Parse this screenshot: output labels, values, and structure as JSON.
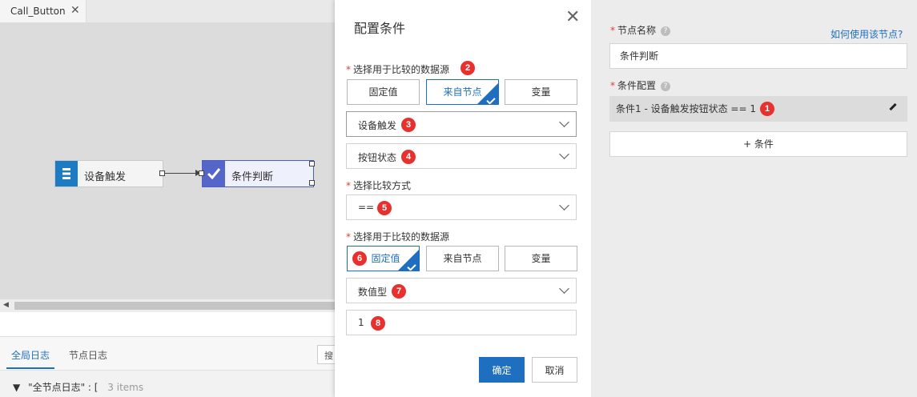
{
  "tab": {
    "title": "Call_Button",
    "close": "✕"
  },
  "canvas": {
    "nodes": [
      {
        "label": "设备触发",
        "icon": "device-trigger-icon"
      },
      {
        "label": "条件判断",
        "icon": "check-icon"
      }
    ]
  },
  "log": {
    "tabs": [
      "全局日志",
      "节点日志"
    ],
    "search_stub": "搜",
    "line": {
      "arrow": "▼",
      "key": "\"全节点日志\" : [",
      "count": "3 items"
    }
  },
  "modal": {
    "title": "配置条件",
    "close": "✕",
    "source1": {
      "label": "选择用于比较的数据源",
      "badge": "2",
      "options": [
        "固定值",
        "来自节点",
        "变量"
      ],
      "selected_index": 1
    },
    "select_device": {
      "value": "设备触发",
      "badge": "3"
    },
    "select_attr": {
      "value": "按钮状态",
      "badge": "4"
    },
    "compare": {
      "label": "选择比较方式",
      "value": "==",
      "badge": "5"
    },
    "source2": {
      "label": "选择用于比较的数据源",
      "badge": "6",
      "options": [
        "固定值",
        "来自节点",
        "变量"
      ],
      "selected_index": 0
    },
    "select_type": {
      "value": "数值型",
      "badge": "7"
    },
    "value_input": {
      "value": "1",
      "badge": "8"
    },
    "ok_label": "确定",
    "cancel_label": "取消"
  },
  "right_panel": {
    "node_name_label": "节点名称",
    "help_link": "如何使用该节点?",
    "node_name_value": "条件判断",
    "cond_config_label": "条件配置",
    "condition_item": "条件1 - 设备触发按钮状态 == 1",
    "condition_badge": "1",
    "add_condition": "+ 条件"
  },
  "colors": {
    "accent": "#1f6fc0",
    "badge": "#e8312f",
    "required": "#e23b3b"
  }
}
